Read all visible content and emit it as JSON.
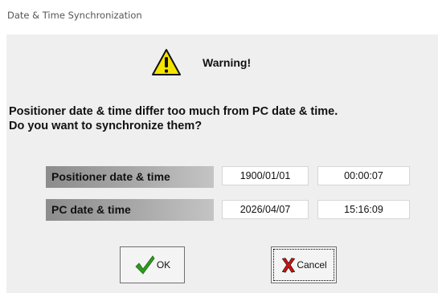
{
  "window": {
    "title": "Date & Time Synchronization"
  },
  "warning": {
    "icon": "warning-icon",
    "heading": "Warning!"
  },
  "message": {
    "line1": "Positioner date & time differ too much from PC date & time.",
    "line2": "Do you want to synchronize them?"
  },
  "table": {
    "rows": [
      {
        "label": "Positioner date & time",
        "date": "1900/01/01",
        "time": "00:00:07"
      },
      {
        "label": "PC date & time",
        "date": "2026/04/07",
        "time": "15:16:09"
      }
    ]
  },
  "buttons": {
    "ok_label": "OK",
    "ok_icon": "checkmark-icon",
    "cancel_label": "Cancel",
    "cancel_icon": "red-x-icon"
  },
  "colors": {
    "dialog_background": "#efefef",
    "warning_yellow": "#f5e400",
    "ok_green": "#2e9a1e",
    "cancel_red": "#d01010"
  }
}
